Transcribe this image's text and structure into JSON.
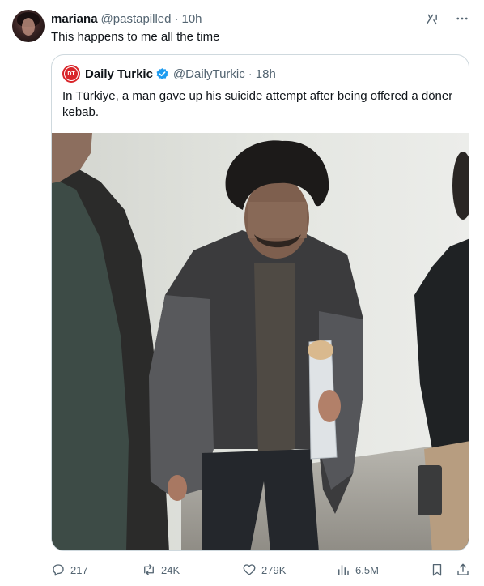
{
  "post": {
    "author_name": "mariana",
    "handle": "@pastapilled",
    "separator": "·",
    "time": "10h",
    "text": "This happens to me all the time"
  },
  "quoted_post": {
    "avatar_text": "DT",
    "author_name": "Daily Turkic",
    "verified": true,
    "handle": "@DailyTurkic",
    "separator": "·",
    "time": "18h",
    "text": "In Türkiye, a man gave up his suicide attempt after being offered a döner kebab."
  },
  "actions": {
    "replies": "217",
    "reposts": "24K",
    "likes": "279K",
    "views": "6.5M"
  },
  "colors": {
    "text_primary": "#0f1419",
    "text_secondary": "#536471",
    "border": "#cfd9de",
    "verified_blue": "#1d9bf0",
    "brand_red": "#d9252a"
  },
  "icons": [
    "grok-icon",
    "more-icon",
    "verified-icon",
    "reply-icon",
    "repost-icon",
    "like-icon",
    "views-icon",
    "bookmark-icon",
    "share-icon"
  ]
}
